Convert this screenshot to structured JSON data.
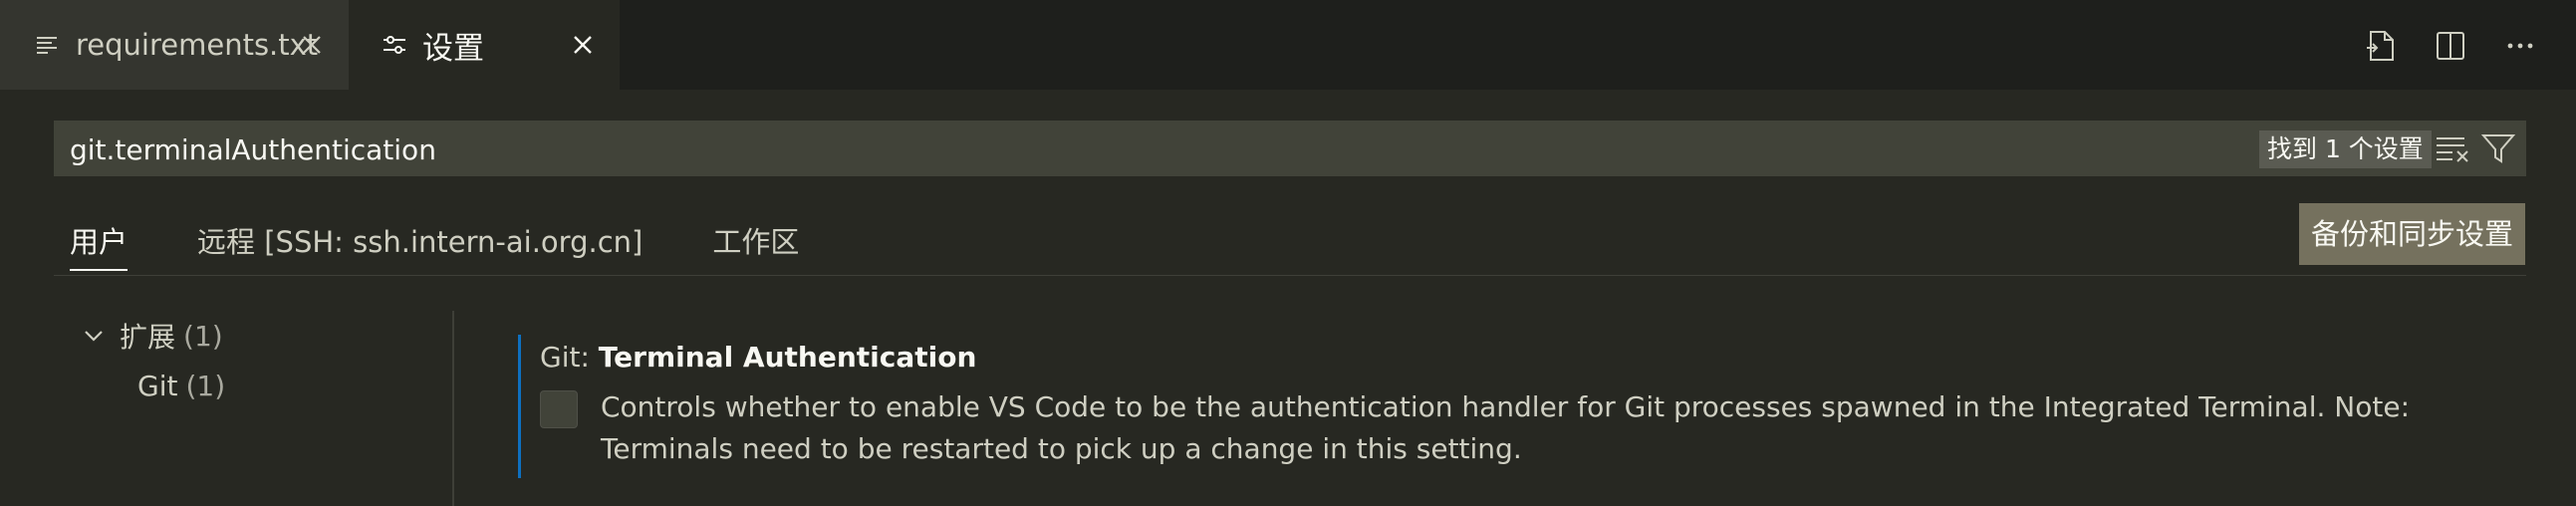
{
  "tabs": [
    {
      "label": "requirements.txt",
      "icon": "list-icon",
      "close": "×"
    },
    {
      "label": "设置",
      "icon": "settings-sliders-icon",
      "close": "×",
      "active": true
    }
  ],
  "editor_actions": [
    "open-json-icon",
    "split-editor-icon",
    "more-icon"
  ],
  "search": {
    "value": "git.terminalAuthentication",
    "result_count": "找到 1 个设置",
    "clear_icon": "clear-filter-icon",
    "filter_icon": "filter-icon"
  },
  "scope_tabs": [
    {
      "label": "用户",
      "active": true
    },
    {
      "label": "远程 [SSH: ssh.intern-ai.org.cn]"
    },
    {
      "label": "工作区"
    }
  ],
  "sync_button": "备份和同步设置",
  "toc": {
    "group": {
      "label": "扩展",
      "count": "(1)"
    },
    "child": {
      "label": "Git",
      "count": "(1)"
    }
  },
  "setting": {
    "category": "Git: ",
    "name": "Terminal Authentication",
    "description": "Controls whether to enable VS Code to be the authentication handler for Git processes spawned in the Integrated Terminal. Note: Terminals need to be restarted to pick up a change in this setting.",
    "checked": false
  },
  "colors": {
    "accent_bar": "#0e70c0",
    "background": "#272822",
    "sync_button": "#75715e"
  }
}
